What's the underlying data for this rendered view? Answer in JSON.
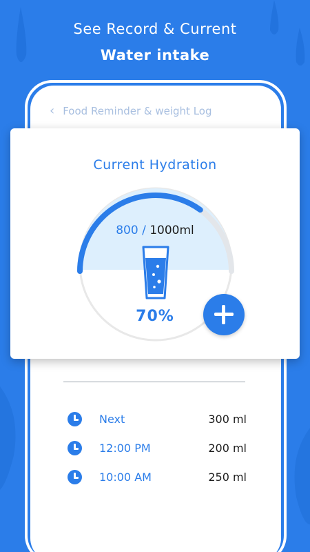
{
  "headline": {
    "line1": "See Record & Current",
    "line2": "Water intake"
  },
  "appbar": {
    "back_icon": "chevron-left-icon",
    "title": "Food Reminder & weight Log"
  },
  "hydration": {
    "title": "Current Hydration",
    "current": "800",
    "separator": "/",
    "target": "1000ml",
    "percent_label": "70%",
    "progress_fraction": 0.7,
    "icon": "water-glass-icon",
    "add_icon": "plus-icon"
  },
  "log": {
    "entries": [
      {
        "time": "Next",
        "amount": "300 ml"
      },
      {
        "time": "12:00 PM",
        "amount": "200 ml"
      },
      {
        "time": "10:00 AM",
        "amount": "250 ml"
      }
    ]
  },
  "colors": {
    "accent": "#2b7de9",
    "background": "#2b7de9",
    "water_fill": "#ddeffd"
  }
}
